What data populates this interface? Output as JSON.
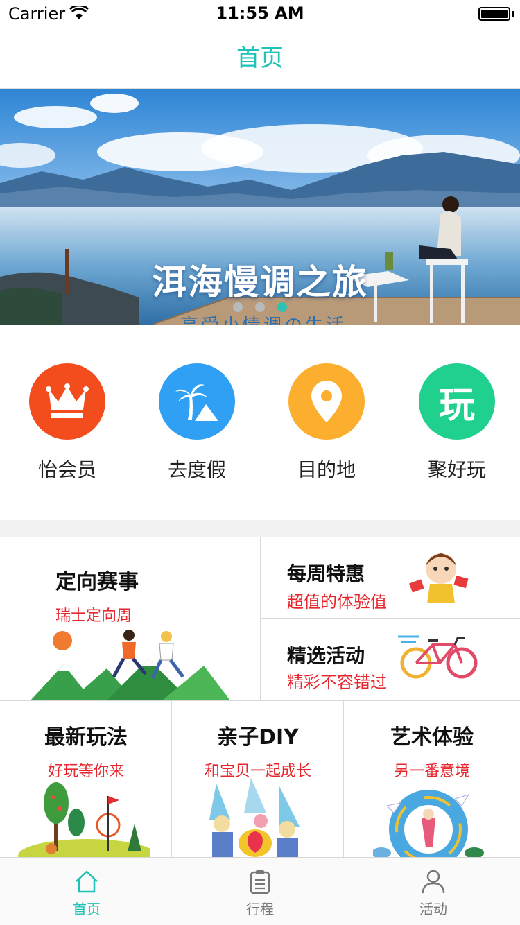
{
  "status_bar": {
    "carrier": "Carrier",
    "time": "11:55 AM"
  },
  "nav": {
    "title": "首页"
  },
  "banner": {
    "title": "洱海慢调之旅",
    "subtitle": "享受小情调の生活",
    "dots": 3,
    "active_dot": 3
  },
  "quick_menu": [
    {
      "label": "怡会员",
      "icon": "crown-icon",
      "color": "#f44d1d"
    },
    {
      "label": "去度假",
      "icon": "palm-tree-icon",
      "color": "#2fa0f4"
    },
    {
      "label": "目的地",
      "icon": "location-pin-icon",
      "color": "#fcae2e"
    },
    {
      "label": "聚好玩",
      "icon": "play-char-icon",
      "glyph": "玩",
      "color": "#1fd08e"
    }
  ],
  "features": {
    "orienteering": {
      "title": "定向赛事",
      "subtitle": "瑞士定向周"
    },
    "weekly_deals": {
      "title": "每周特惠",
      "subtitle": "超值的体验值"
    },
    "featured_activities": {
      "title": "精选活动",
      "subtitle": "精彩不容错过"
    },
    "new_ways": {
      "title": "最新玩法",
      "subtitle": "好玩等你来"
    },
    "parent_child_diy": {
      "title": "亲子DIY",
      "subtitle": "和宝贝一起成长"
    },
    "art_experience": {
      "title": "艺术体验",
      "subtitle": "另一番意境"
    }
  },
  "tab_bar": [
    {
      "label": "首页",
      "icon": "home-icon",
      "active": true
    },
    {
      "label": "行程",
      "icon": "clipboard-icon",
      "active": false
    },
    {
      "label": "活动",
      "icon": "person-icon",
      "active": false
    }
  ],
  "colors": {
    "accent": "#1fc2b6",
    "subtitle_red": "#e8262d"
  }
}
